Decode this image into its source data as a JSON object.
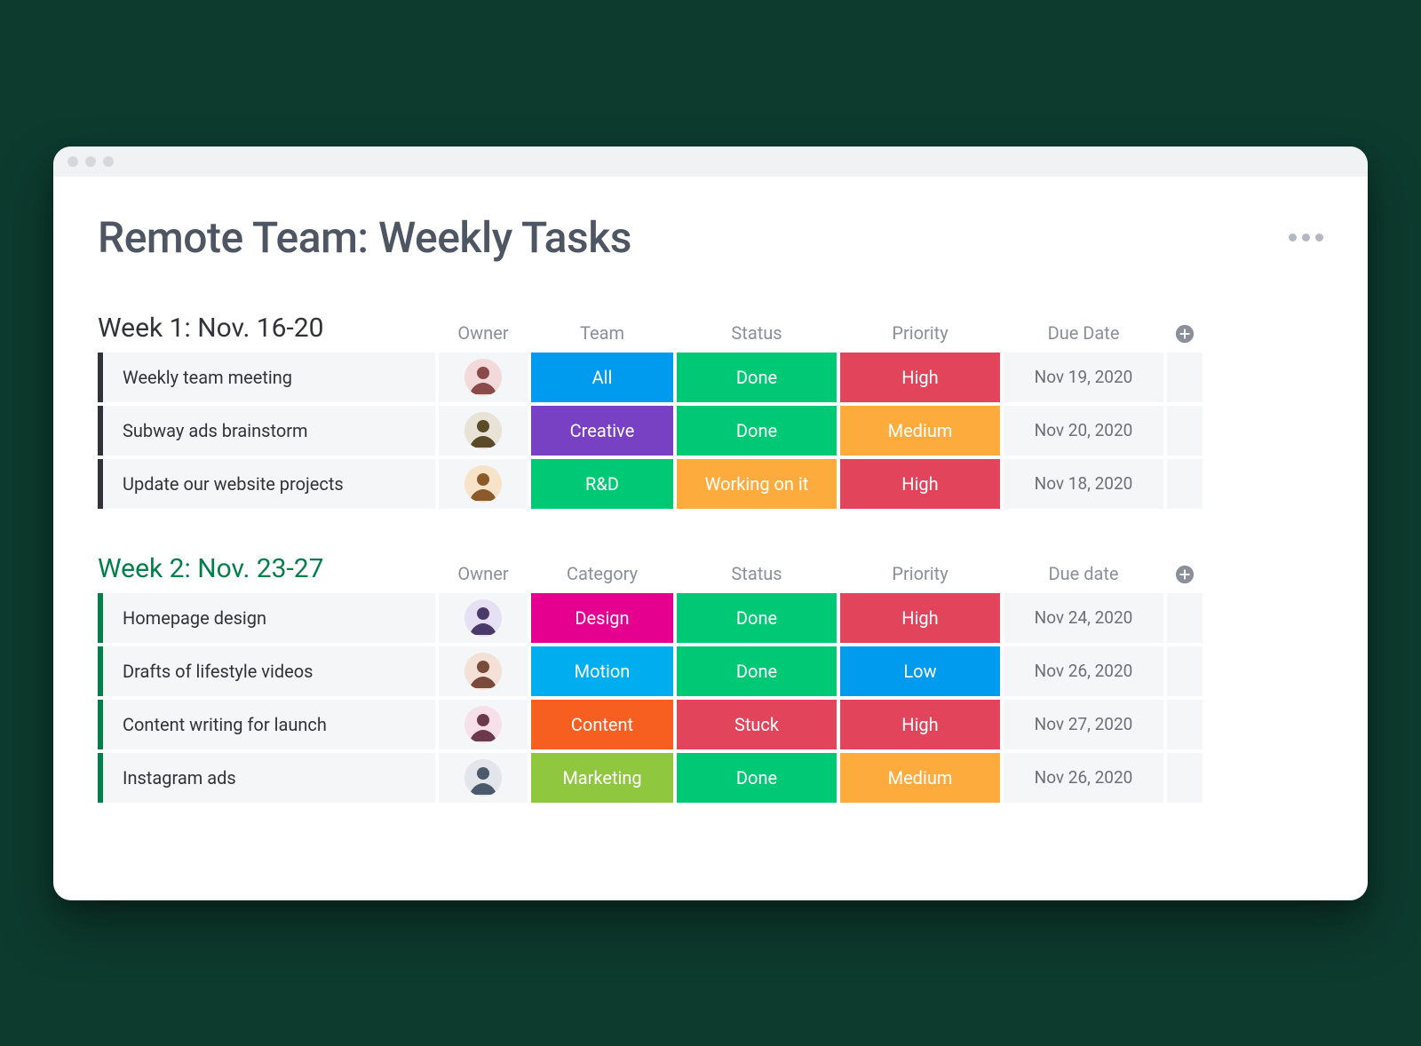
{
  "board_title": "Remote Team: Weekly Tasks",
  "groups": [
    {
      "title": "Week 1: Nov. 16-20",
      "accent": "dark",
      "columns": [
        "Owner",
        "Team",
        "Status",
        "Priority",
        "Due Date"
      ],
      "rows": [
        {
          "task": "Weekly team meeting",
          "owner_avatar": "a1",
          "cat": {
            "label": "All",
            "class": "c-all"
          },
          "status": {
            "label": "Done",
            "class": "s-done"
          },
          "priority": {
            "label": "High",
            "class": "p-high"
          },
          "due": "Nov 19, 2020"
        },
        {
          "task": "Subway ads brainstorm",
          "owner_avatar": "a2",
          "cat": {
            "label": "Creative",
            "class": "c-creative"
          },
          "status": {
            "label": "Done",
            "class": "s-done"
          },
          "priority": {
            "label": "Medium",
            "class": "p-medium"
          },
          "due": "Nov 20, 2020"
        },
        {
          "task": "Update our website projects",
          "owner_avatar": "a3",
          "cat": {
            "label": "R&D",
            "class": "c-rd"
          },
          "status": {
            "label": "Working on it",
            "class": "s-working"
          },
          "priority": {
            "label": "High",
            "class": "p-high"
          },
          "due": "Nov 18, 2020"
        }
      ]
    },
    {
      "title": "Week 2: Nov. 23-27",
      "accent": "green",
      "columns": [
        "Owner",
        "Category",
        "Status",
        "Priority",
        "Due date"
      ],
      "rows": [
        {
          "task": "Homepage design",
          "owner_avatar": "a4",
          "cat": {
            "label": "Design",
            "class": "c-design"
          },
          "status": {
            "label": "Done",
            "class": "s-done"
          },
          "priority": {
            "label": "High",
            "class": "p-high"
          },
          "due": "Nov 24, 2020"
        },
        {
          "task": "Drafts of lifestyle videos",
          "owner_avatar": "a5",
          "cat": {
            "label": "Motion",
            "class": "c-motion"
          },
          "status": {
            "label": "Done",
            "class": "s-done"
          },
          "priority": {
            "label": "Low",
            "class": "p-low"
          },
          "due": "Nov 26, 2020"
        },
        {
          "task": "Content writing for launch",
          "owner_avatar": "a6",
          "cat": {
            "label": "Content",
            "class": "c-content"
          },
          "status": {
            "label": "Stuck",
            "class": "s-stuck"
          },
          "priority": {
            "label": "High",
            "class": "p-high"
          },
          "due": "Nov 27, 2020"
        },
        {
          "task": "Instagram ads",
          "owner_avatar": "a7",
          "cat": {
            "label": "Marketing",
            "class": "c-marketing"
          },
          "status": {
            "label": "Done",
            "class": "s-done"
          },
          "priority": {
            "label": "Medium",
            "class": "p-medium"
          },
          "due": "Nov 26, 2020"
        }
      ]
    }
  ],
  "avatar_colors": {
    "a1": {
      "bg": "#f3d9d9",
      "fg": "#8a4a4a"
    },
    "a2": {
      "bg": "#e9e2d6",
      "fg": "#5a4a2a"
    },
    "a3": {
      "bg": "#f7e3c8",
      "fg": "#8a5a2a"
    },
    "a4": {
      "bg": "#e6e0f5",
      "fg": "#4a3a6a"
    },
    "a5": {
      "bg": "#f5e0d6",
      "fg": "#7a4a3a"
    },
    "a6": {
      "bg": "#f8e0ea",
      "fg": "#6a3a4a"
    },
    "a7": {
      "bg": "#e2e6ea",
      "fg": "#4a5a6a"
    }
  }
}
